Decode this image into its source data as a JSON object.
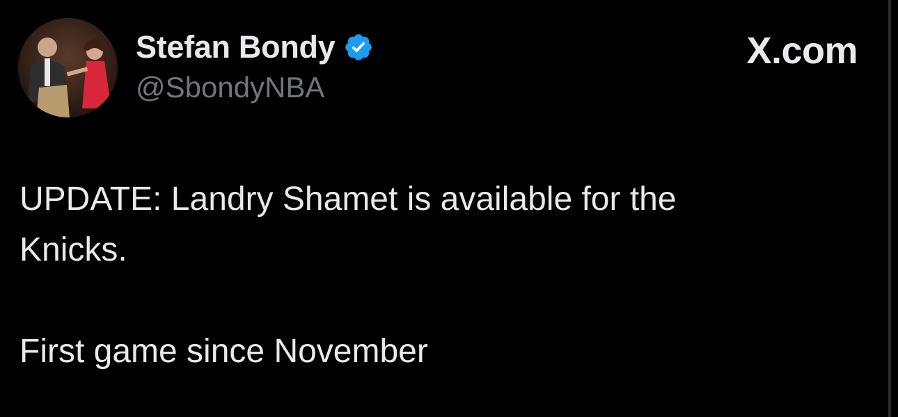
{
  "author": {
    "display_name": "Stefan Bondy",
    "handle": "@SbondyNBA",
    "verified_icon": "verified-badge-icon",
    "verified_color": "#1d9bf0"
  },
  "brand": {
    "label": "X.com"
  },
  "tweet": {
    "line1": "UPDATE: Landry Shamet is available for the",
    "line2": "Knicks.",
    "line3": "First game since November"
  },
  "colors": {
    "background": "#000000",
    "text_primary": "#e7e9ea",
    "text_secondary": "#71767b"
  }
}
